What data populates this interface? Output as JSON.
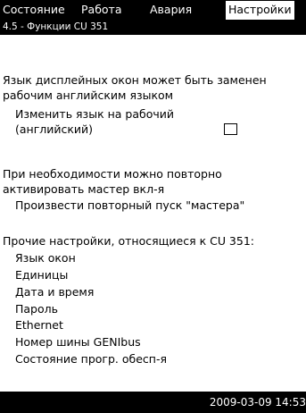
{
  "tabs": {
    "status": "Состояние",
    "operation": "Работа",
    "alarm": "Авария",
    "settings": "Настройки"
  },
  "subtitle": "4.5 - Функции CU 351",
  "language": {
    "line1": "Язык дисплейных окон может быть заменен",
    "line2": "рабочим английским языком",
    "option_line1": "Изменить язык на рабочий",
    "option_line2": "(английский)",
    "checked": false
  },
  "wizard": {
    "line1": "При необходимости можно повторно",
    "line2": "активировать мастер вкл-я",
    "action": "Произвести повторный пуск \"мастера\""
  },
  "other": {
    "heading": "Прочие настройки, относящиеся к CU 351:",
    "items": [
      "Язык окон",
      "Единицы",
      "Дата и время",
      "Пароль",
      "Ethernet",
      "Номер шины GENIbus",
      "Состояние прогр. обесп-я"
    ]
  },
  "footer": {
    "datetime": "2009-03-09 14:53"
  }
}
